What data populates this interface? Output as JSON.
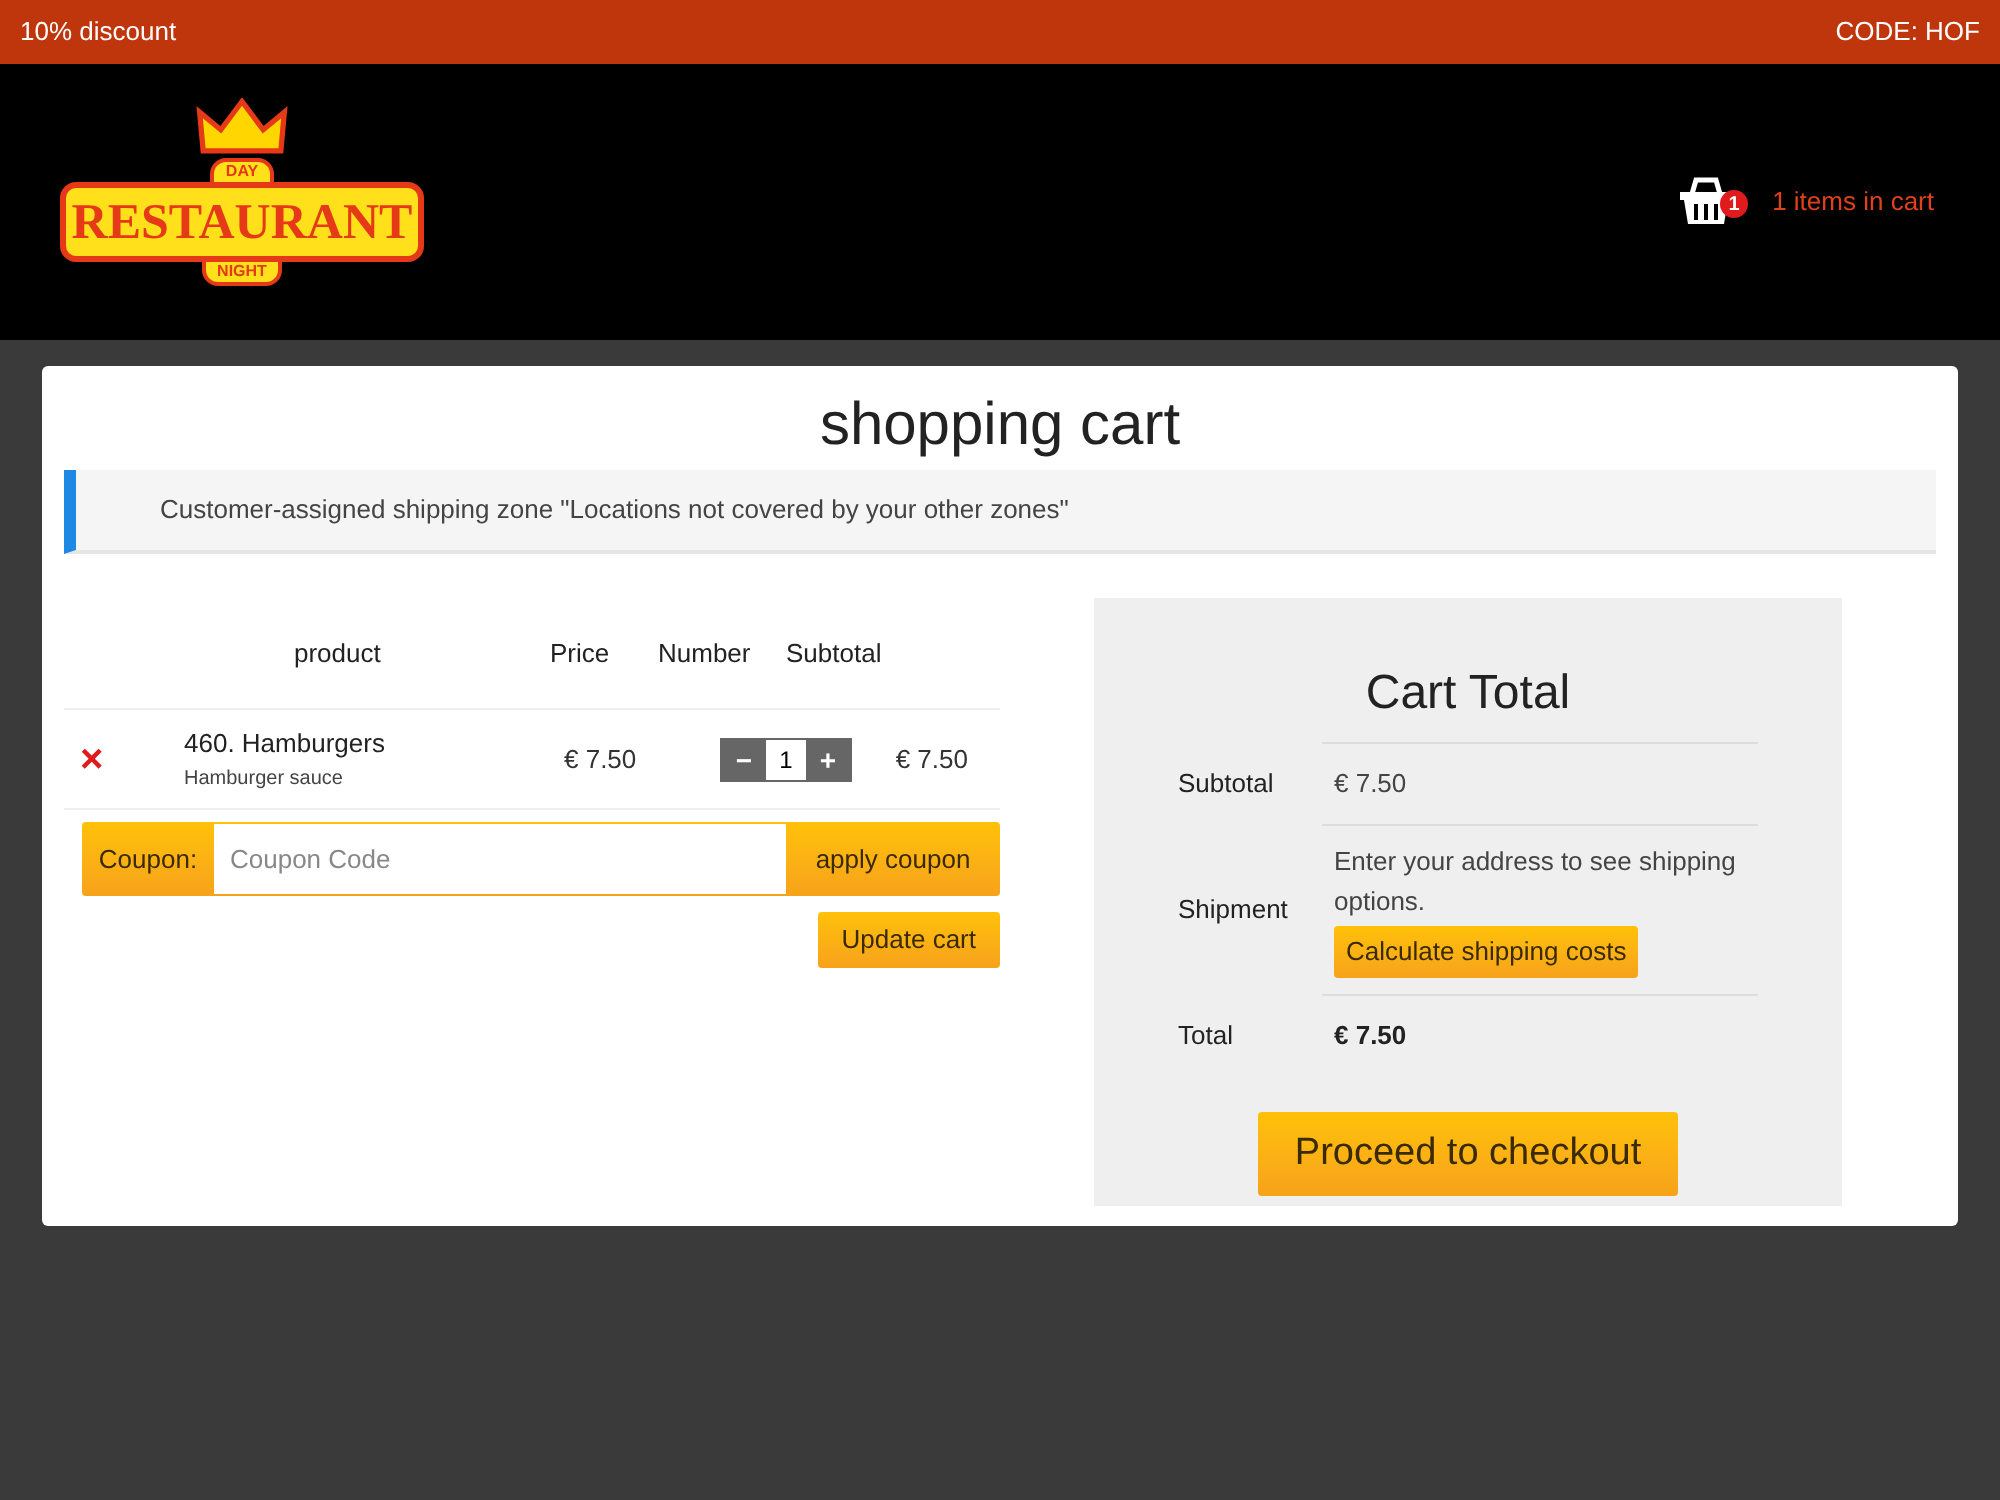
{
  "promo_bar": {
    "left": "10% discount",
    "right": "CODE: HOF"
  },
  "header": {
    "logo": {
      "top": "DAY",
      "main": "RESTAURANT",
      "bottom": "NIGHT"
    },
    "cart_badge": "1",
    "cart_link": "1 items in cart"
  },
  "page_title": "shopping cart",
  "notice": "Customer-assigned shipping zone \"Locations not covered by your other zones\"",
  "cart_table": {
    "columns": [
      "product",
      "Price",
      "Number",
      "Subtotal"
    ],
    "rows": [
      {
        "remove": "×",
        "name": "460. Hamburgers",
        "option": "Hamburger sauce",
        "price": "€ 7.50",
        "minus": "−",
        "quantity": "1",
        "plus": "+",
        "subtotal": "€ 7.50"
      }
    ]
  },
  "coupon": {
    "label": "Coupon:",
    "placeholder": "Coupon Code",
    "button": "apply coupon"
  },
  "update_button": "Update cart",
  "totals": {
    "title": "Cart Total",
    "rows": [
      {
        "kind": "value",
        "label": "Subtotal",
        "value": "€ 7.50"
      },
      {
        "kind": "shipping",
        "label": "Shipment",
        "value": "Enter your address to see shipping options.",
        "button": "Calculate shipping costs"
      },
      {
        "kind": "total",
        "label": "Total",
        "value": "€ 7.50"
      }
    ],
    "checkout_button": "Proceed to checkout"
  }
}
